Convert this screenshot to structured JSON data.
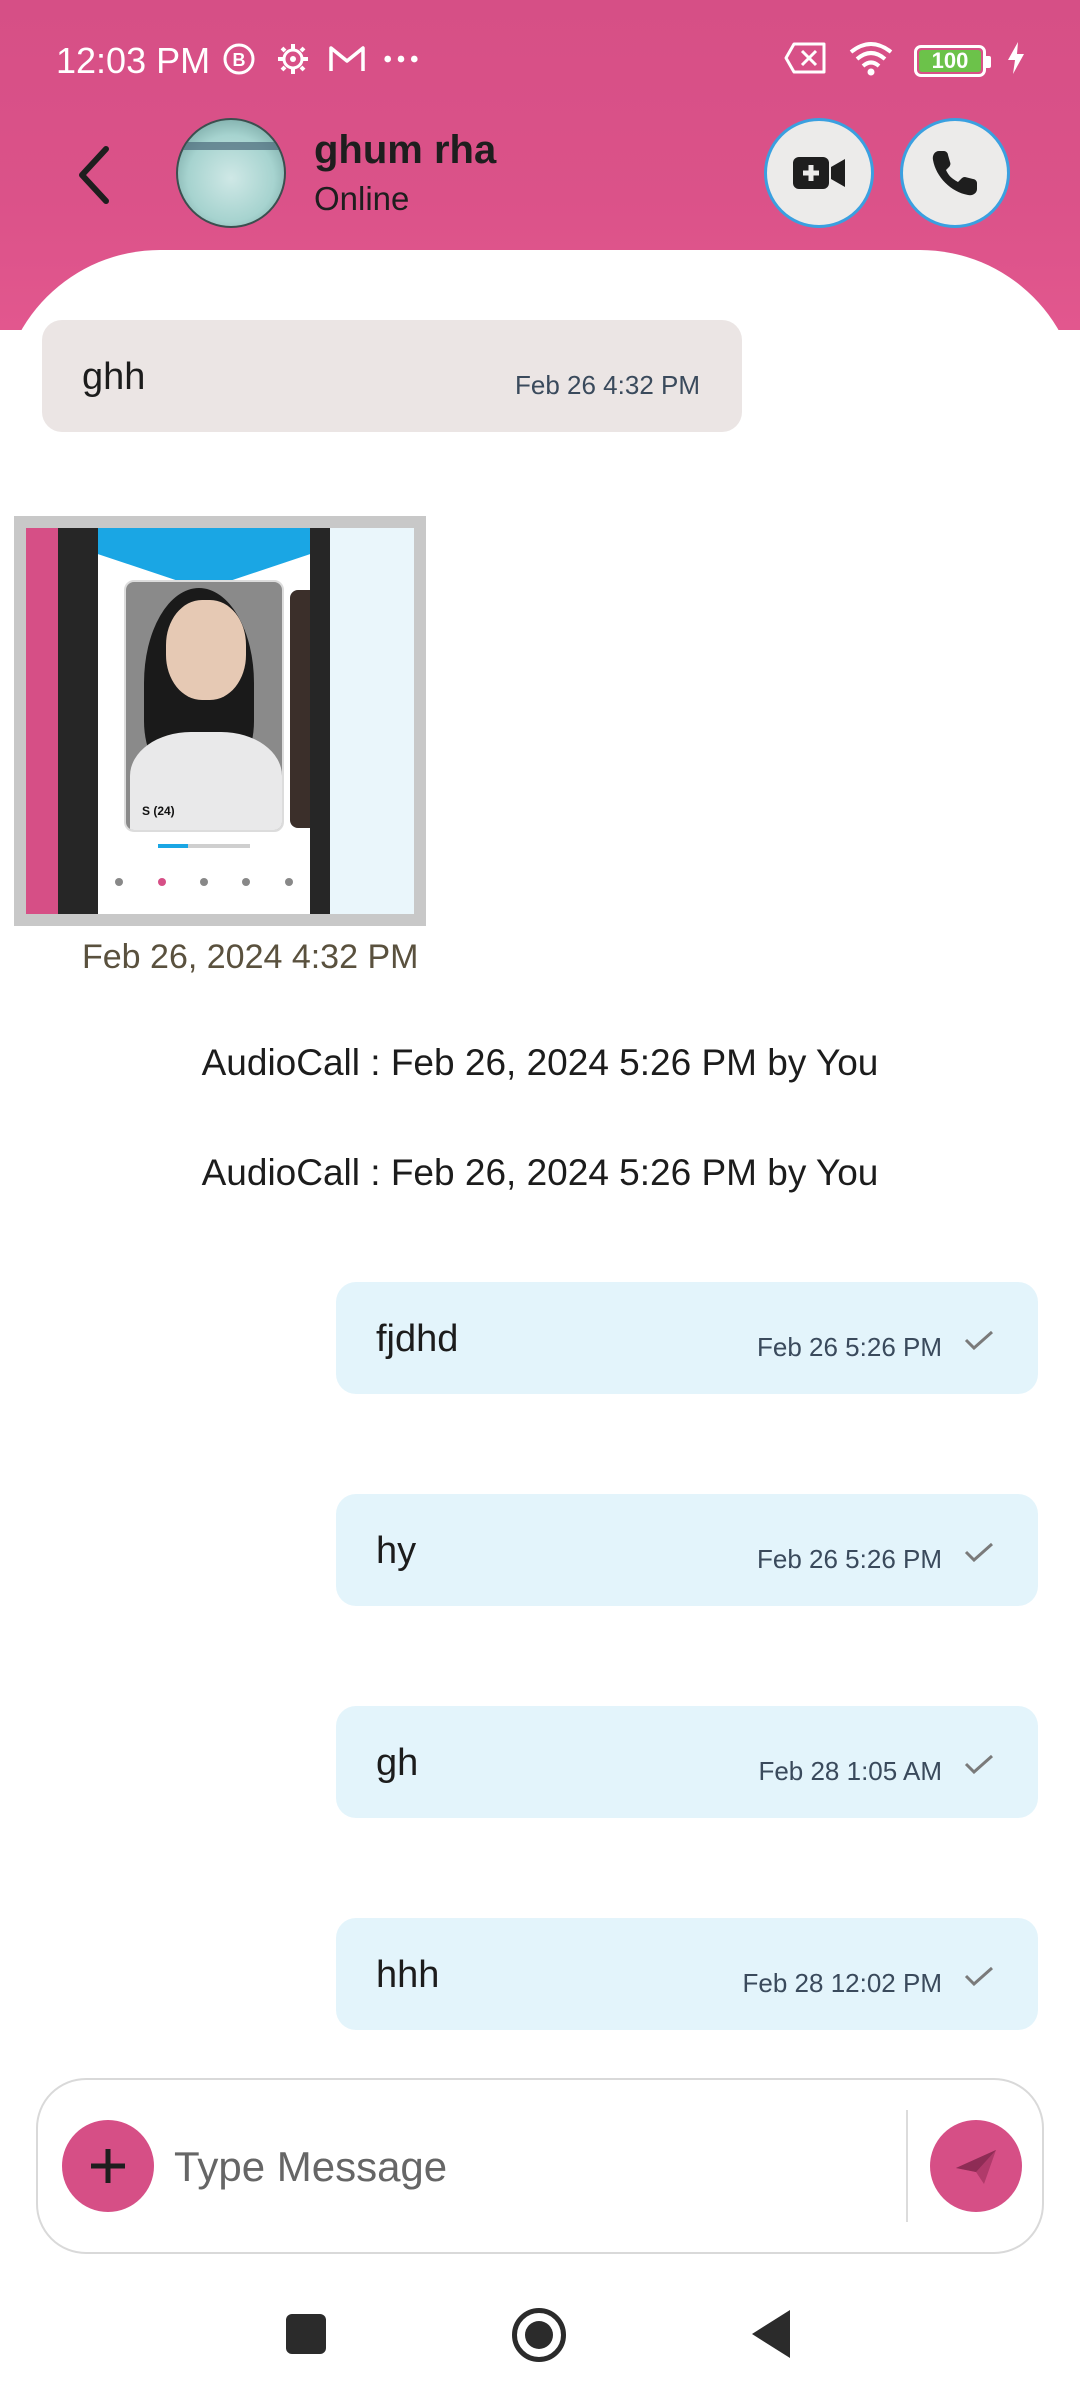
{
  "status_bar": {
    "time": "12:03 PM",
    "left_icons": [
      "b-circle-icon",
      "gear-icon",
      "gmail-icon",
      "more-dots-icon"
    ],
    "battery": "100",
    "right_icons": [
      "sim-none-icon",
      "wifi-icon",
      "battery-icon",
      "charging-icon"
    ]
  },
  "header": {
    "contact_name": "ghum rha",
    "contact_status": "Online",
    "accent_color": "#d64f86"
  },
  "messages": {
    "incoming_1": {
      "text": "ghh",
      "time": "Feb 26 4:32 PM"
    },
    "image_message": {
      "time": "Feb 26, 2024 4:32 PM",
      "card_label": "S (24)"
    },
    "call_logs": [
      "AudioCall : Feb 26, 2024 5:26 PM by You",
      "AudioCall : Feb 26, 2024 5:26 PM by You"
    ],
    "outgoing": [
      {
        "text": "fjdhd",
        "time": "Feb 26 5:26 PM"
      },
      {
        "text": "hy",
        "time": "Feb 26 5:26 PM"
      },
      {
        "text": "gh",
        "time": "Feb 28 1:05 AM"
      },
      {
        "text": "hhh",
        "time": "Feb 28 12:02 PM"
      }
    ]
  },
  "composer": {
    "placeholder": "Type Message"
  }
}
